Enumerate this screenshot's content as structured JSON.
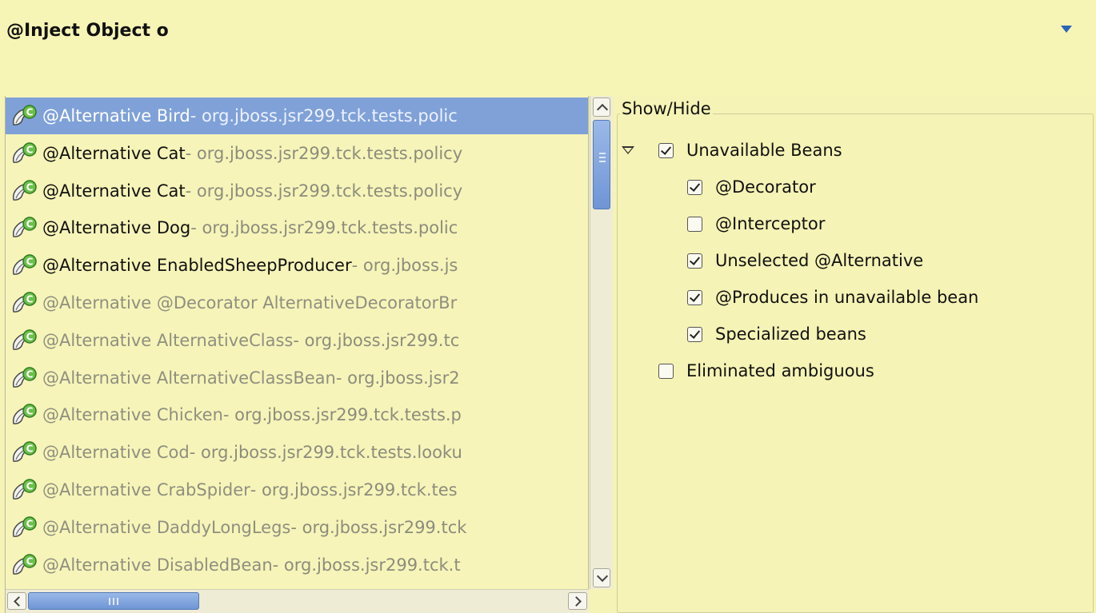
{
  "header": {
    "title": "@Inject Object o"
  },
  "beans": [
    {
      "name": "@Alternative Bird",
      "pkg": " - org.jboss.jsr299.tck.tests.polic",
      "selected": true,
      "dim": false
    },
    {
      "name": "@Alternative Cat",
      "pkg": " - org.jboss.jsr299.tck.tests.policy",
      "selected": false,
      "dim": false
    },
    {
      "name": "@Alternative Cat",
      "pkg": " - org.jboss.jsr299.tck.tests.policy",
      "selected": false,
      "dim": false
    },
    {
      "name": "@Alternative Dog",
      "pkg": " - org.jboss.jsr299.tck.tests.polic",
      "selected": false,
      "dim": false
    },
    {
      "name": "@Alternative EnabledSheepProducer",
      "pkg": " - org.jboss.js",
      "selected": false,
      "dim": false
    },
    {
      "name": "@Alternative @Decorator AlternativeDecoratorBr",
      "pkg": "",
      "selected": false,
      "dim": true
    },
    {
      "name": "@Alternative AlternativeClass",
      "pkg": " - org.jboss.jsr299.tc",
      "selected": false,
      "dim": true
    },
    {
      "name": "@Alternative AlternativeClassBean",
      "pkg": " - org.jboss.jsr2",
      "selected": false,
      "dim": true
    },
    {
      "name": "@Alternative Chicken",
      "pkg": " - org.jboss.jsr299.tck.tests.p",
      "selected": false,
      "dim": true
    },
    {
      "name": "@Alternative Cod",
      "pkg": " - org.jboss.jsr299.tck.tests.looku",
      "selected": false,
      "dim": true
    },
    {
      "name": "@Alternative CrabSpider",
      "pkg": " - org.jboss.jsr299.tck.tes",
      "selected": false,
      "dim": true
    },
    {
      "name": "@Alternative DaddyLongLegs",
      "pkg": " - org.jboss.jsr299.tck",
      "selected": false,
      "dim": true
    },
    {
      "name": "@Alternative DisabledBean",
      "pkg": " - org.jboss.jsr299.tck.t",
      "selected": false,
      "dim": true
    }
  ],
  "filter": {
    "group_label": "Show/Hide",
    "unavailable": {
      "label": "Unavailable Beans",
      "checked": true,
      "expanded": true
    },
    "options": [
      {
        "label": "@Decorator",
        "checked": true
      },
      {
        "label": "@Interceptor",
        "checked": false
      },
      {
        "label": "Unselected @Alternative",
        "checked": true
      },
      {
        "label": "@Produces in unavailable bean",
        "checked": true
      },
      {
        "label": "Specialized beans",
        "checked": true
      }
    ],
    "ambiguous": {
      "label": "Eliminated ambiguous",
      "checked": false
    }
  },
  "colors": {
    "background": "#f5f3b5",
    "selection": "#7fa1d8",
    "dim_text": "#8f8f80",
    "package_text": "#8c8c7d"
  },
  "icons": {
    "bean": "bean-icon",
    "menu": "chevron-down-icon"
  }
}
